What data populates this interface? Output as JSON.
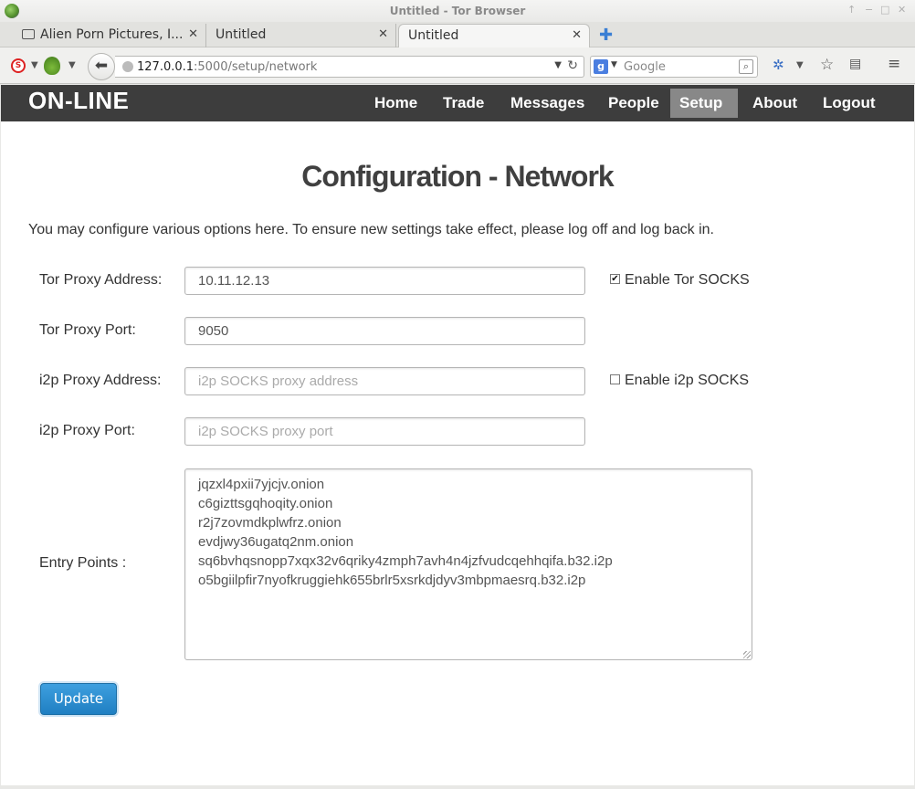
{
  "window": {
    "title": "Untitled - Tor Browser",
    "controls": [
      "↑",
      "−",
      "□",
      "✕"
    ]
  },
  "tabs": [
    {
      "label": "Alien Porn Pictures, I...",
      "close": "✕"
    },
    {
      "label": "Untitled",
      "close": "✕"
    },
    {
      "label": "Untitled",
      "close": "✕",
      "active": true
    }
  ],
  "newtab": "✚",
  "toolbar": {
    "url_host": "127.0.0.1",
    "url_path": ":5000/setup/network",
    "search_placeholder": "Google",
    "search_engine": "g",
    "icons": [
      "noscript-icon",
      "tor-onion-icon",
      "back-arrow-icon",
      "globe-icon",
      "reload-icon",
      "google-icon",
      "search-icon",
      "https-everywhere-icon",
      "star-icon",
      "reader-icon",
      "hamburger-menu-icon"
    ]
  },
  "site": {
    "brand": "ON-LINE",
    "nav": [
      "Home",
      "Trade",
      "Messages",
      "People",
      "Setup",
      "About",
      "Logout"
    ],
    "active_nav": "Setup"
  },
  "page": {
    "title": "Configuration - Network",
    "intro": "You may configure various options here. To ensure new settings take effect, please log off and log back in."
  },
  "form": {
    "tor_address": {
      "label": "Tor Proxy Address:",
      "value": "10.11.12.13",
      "placeholder": ""
    },
    "tor_port": {
      "label": "Tor Proxy Port:",
      "value": "9050",
      "placeholder": ""
    },
    "i2p_address": {
      "label": "i2p Proxy Address:",
      "value": "",
      "placeholder": "i2p SOCKS proxy address"
    },
    "i2p_port": {
      "label": "i2p Proxy Port:",
      "value": "",
      "placeholder": "i2p SOCKS proxy port"
    },
    "enable_tor": {
      "label": "Enable Tor SOCKS",
      "checked": true,
      "mark": "✔"
    },
    "enable_i2p": {
      "label": "Enable i2p SOCKS",
      "checked": false,
      "mark": ""
    },
    "entry_points": {
      "label": "Entry Points :",
      "lines": [
        "jqzxl4pxii7yjcjv.onion",
        "c6gizttsgqhoqity.onion",
        "r2j7zovmdkplwfrz.onion",
        "evdjwy36ugatq2nm.onion",
        "sq6bvhqsnopp7xqx32v6qriky4zmph7avh4n4jzfvudcqehhqifa.b32.i2p",
        "o5bgiilpfir7nyofkruggiehk655brlr5xsrkdjdyv3mbpmaesrq.b32.i2p"
      ]
    },
    "update_label": "Update"
  }
}
